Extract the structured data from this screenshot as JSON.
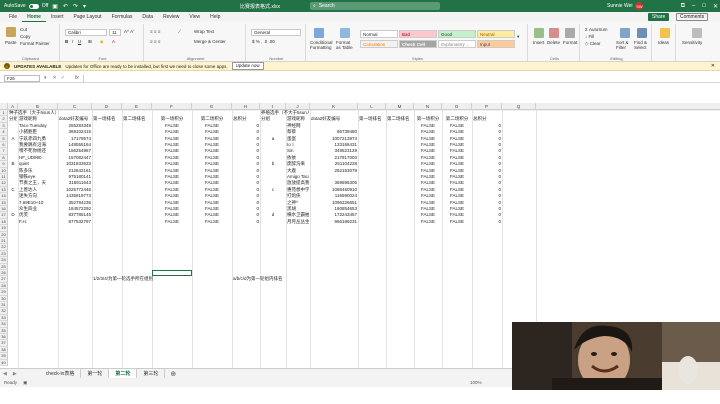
{
  "titlebar": {
    "autosave": "AutoSave",
    "autosave_state": "Off",
    "doc_title": "比赛报表格式.xlsx",
    "search_placeholder": "Search",
    "user_name": "Sunnie Wei",
    "user_initials": "SW"
  },
  "menu": [
    "File",
    "Home",
    "Insert",
    "Page Layout",
    "Formulas",
    "Data",
    "Review",
    "View",
    "Help"
  ],
  "share_label": "Share",
  "comments_label": "Comments",
  "ribbon": {
    "paste": "Paste",
    "cut": "Cut",
    "copy": "Copy",
    "format_painter": "Format Painter",
    "clipboard": "Clipboard",
    "font_name": "Calibri",
    "font_size": "11",
    "font": "Font",
    "wrap_text": "Wrap Text",
    "merge_center": "Merge & Center",
    "alignment": "Alignment",
    "number_format": "General",
    "number": "Number",
    "conditional": "Conditional Formatting",
    "format_as_table": "Format as Table",
    "styles": [
      "Normal",
      "Bad",
      "Good",
      "Neutral",
      "Calculation",
      "Check Cell",
      "Explanatory ...",
      "Input"
    ],
    "styles_label": "Styles",
    "insert": "Insert",
    "delete": "Delete",
    "format": "Format",
    "cells": "Cells",
    "autosum": "AutoSum",
    "fill": "Fill",
    "clear": "Clear",
    "sort_filter": "Sort & Filter",
    "find_select": "Find & Select",
    "editing": "Editing",
    "ideas": "Ideas",
    "sensitivity": "Sensitivity"
  },
  "notice": {
    "badge": "UPDATES AVAILABLE",
    "text": "Updates for Office are ready to be installed, but first we need to close some apps.",
    "button": "Update now"
  },
  "formula": {
    "namebox": "F26",
    "fx": "fx"
  },
  "columns": [
    "A",
    "B",
    "C",
    "D",
    "E",
    "F",
    "G",
    "H",
    "I",
    "J",
    "K",
    "L",
    "M",
    "N",
    "O",
    "P",
    "Q"
  ],
  "rows": [
    "1",
    "2",
    "3",
    "4",
    "5",
    "6",
    "7",
    "8",
    "9",
    "10",
    "11",
    "12",
    "13",
    "14",
    "15",
    "16",
    "17",
    "18",
    "19",
    "20",
    "21",
    "22",
    "23",
    "24",
    "25",
    "26",
    "27",
    "28",
    "29",
    "30",
    "31",
    "32",
    "33",
    "34",
    "35",
    "36",
    "37",
    "38",
    "39",
    "40"
  ],
  "left_table": {
    "title": "种子选手（大于5sun人）",
    "headers": [
      "分组",
      "游戏昵称",
      "dota2好友编号",
      "第一场排名",
      "第二场排名",
      "第一场积分",
      "第二场积分",
      "总积分"
    ],
    "groups": [
      "A",
      "B",
      "C",
      "D"
    ],
    "rows": [
      [
        "Taco Tuesday",
        "255283348",
        "FALSE",
        "FALSE",
        "0"
      ],
      [
        "小猪鲍臣",
        "369102415",
        "FALSE",
        "FALSE",
        "0"
      ],
      [
        "宁玖赤四九勇",
        "17179574",
        "FALSE",
        "FALSE",
        "0"
      ],
      [
        "我要跳有沿海",
        "148555164",
        "FALSE",
        "FALSE",
        "0"
      ],
      [
        "嘿不死你杨还",
        "156254967",
        "FALSE",
        "FALSE",
        "0"
      ],
      [
        "HF_UD990",
        "157082447",
        "FALSE",
        "FALSE",
        "0"
      ],
      [
        "quiet",
        "1031833533",
        "FALSE",
        "FALSE",
        "0"
      ],
      [
        "陈多乐",
        "212642161",
        "FALSE",
        "FALSE",
        "0"
      ],
      [
        "钢铁eye",
        "975180141",
        "FALSE",
        "FALSE",
        "0"
      ],
      [
        "节奏之王，天",
        "315911643",
        "FALSE",
        "FALSE",
        "0"
      ],
      [
        "上善达人",
        "1025772446",
        "FALSE",
        "FALSE",
        "0"
      ],
      [
        "迷失方向",
        "1435919773",
        "FALSE",
        "FALSE",
        "0"
      ],
      [
        "7.69E10+10",
        "352784236",
        "FALSE",
        "FALSE",
        "0"
      ],
      [
        "众生四业",
        "184572292",
        "FALSE",
        "FALSE",
        "0"
      ],
      [
        "优芙",
        "837785145",
        "FALSE",
        "FALSE",
        "0"
      ],
      [
        "F.H.",
        "877532797",
        "FALSE",
        "FALSE",
        "0"
      ]
    ],
    "note": "1/2/3/4/为第一轮选手所在组别"
  },
  "right_table": {
    "title": "养殖选手（不大于5sun人）",
    "headers": [
      "分组",
      "游戏昵称",
      "dota2好友编号",
      "第一场排名",
      "第二场排名",
      "第一场积分",
      "第二场积分",
      "总积分"
    ],
    "groups": [
      "a",
      "b",
      "c",
      "d"
    ],
    "rows": [
      [
        "神经网",
        "",
        "FALSE",
        "FALSE",
        "0"
      ],
      [
        "蔡蔡",
        "86739480",
        "FALSE",
        "FALSE",
        "0"
      ],
      [
        "蛋蛋",
        "1007213974",
        "FALSE",
        "FALSE",
        "0"
      ],
      [
        "Iо丨",
        "133166431",
        "FALSE",
        "FALSE",
        "0"
      ],
      [
        "Sin",
        "349523129",
        "FALSE",
        "FALSE",
        "0"
      ],
      [
        "依依",
        "217817003",
        "FALSE",
        "FALSE",
        "0"
      ],
      [
        "废醉沟来",
        "251104228",
        "FALSE",
        "FALSE",
        "0"
      ],
      [
        "大鹿",
        "252153079",
        "FALSE",
        "FALSE",
        "0"
      ],
      [
        "Amigo Taco Burrito",
        "",
        "FALSE",
        "FALSE",
        "0"
      ],
      [
        "放放提高我最被",
        "369696305",
        "FALSE",
        "FALSE",
        "0"
      ],
      [
        "惠苑想中学最后!",
        "1088450910",
        "FALSE",
        "FALSE",
        "0"
      ],
      [
        "打炮侠",
        "116590024",
        "FALSE",
        "FALSE",
        "0"
      ],
      [
        "之神^",
        "1096226651",
        "FALSE",
        "FALSE",
        "0"
      ],
      [
        "黑胡",
        "160854653",
        "FALSE",
        "FALSE",
        "0"
      ],
      [
        "横水卫霸抽搬摆",
        "172243457",
        "FALSE",
        "FALSE",
        "0"
      ],
      [
        "月月丛丛生",
        "966189231",
        "FALSE",
        "FALSE",
        "0"
      ]
    ],
    "note": "a/b/c/d为第一轮组内排名"
  },
  "sheet_tabs": [
    "check-in表格",
    "第一轮",
    "第二轮",
    "第三轮"
  ],
  "active_tab": "第二轮",
  "status": "Ready",
  "zoom": "100%"
}
